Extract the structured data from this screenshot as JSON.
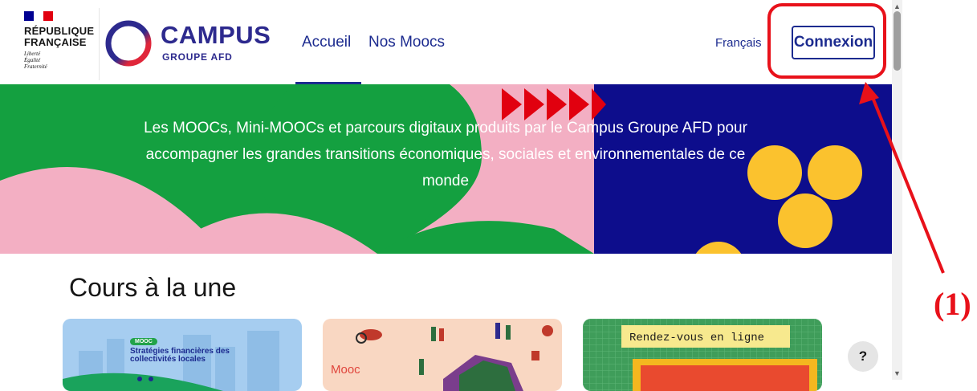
{
  "republique": {
    "name_line1": "RÉPUBLIQUE",
    "name_line2": "FRANÇAISE",
    "motto_1": "Liberté",
    "motto_2": "Égalité",
    "motto_3": "Fraternité"
  },
  "logo": {
    "title": "CAMPUS",
    "subtitle": "GROUPE AFD"
  },
  "nav": {
    "items": [
      {
        "label": "Accueil",
        "active": true
      },
      {
        "label": "Nos Moocs",
        "active": false
      }
    ]
  },
  "header": {
    "language": "Français",
    "login_label": "Connexion"
  },
  "banner": {
    "text": "Les MOOCs, Mini-MOOCs et parcours digitaux produits par le Campus Groupe AFD pour accompagner les grandes transitions économiques, sociales et environnementales de ce monde"
  },
  "featured": {
    "title": "Cours à la une",
    "cards": [
      {
        "tag": "MOOC",
        "title": "Stratégies financières des collectivités locales"
      },
      {
        "tag": "Mooc"
      },
      {
        "title": "Rendez-vous en ligne"
      }
    ]
  },
  "help": {
    "label": "?"
  },
  "annotation": {
    "label": "(1)"
  },
  "colors": {
    "brand_blue": "#1c2b8f",
    "banner_green": "#14a040",
    "banner_pink": "#f3afc3",
    "banner_navy": "#0d0d8c",
    "banner_yellow": "#fbc22e",
    "banner_red": "#e1000f",
    "annotation_red": "#e8111a"
  },
  "icons": [
    "republique-flag-icon",
    "campus-ring-icon",
    "help-icon",
    "scroll-up-icon",
    "scroll-down-icon",
    "annotation-arrow-icon"
  ]
}
